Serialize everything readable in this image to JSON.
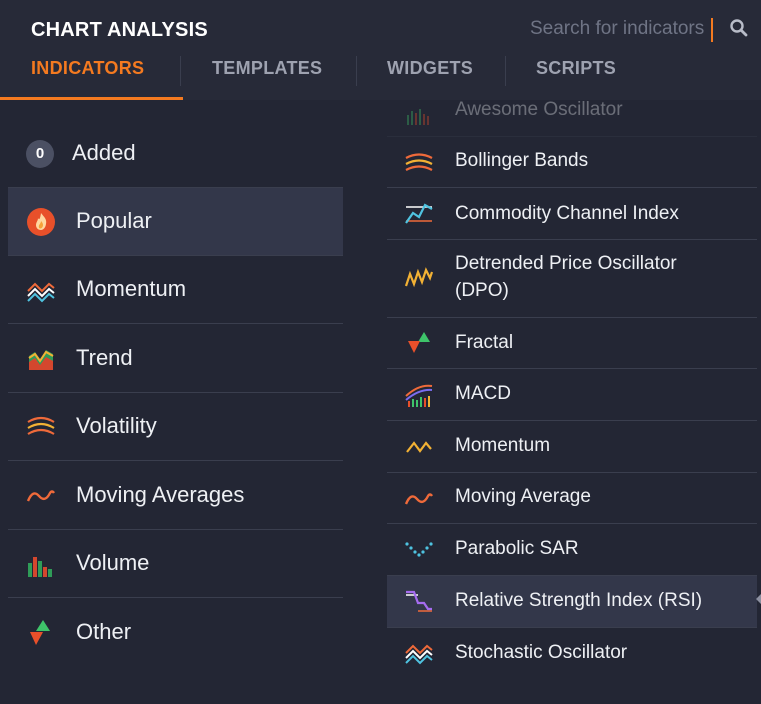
{
  "header": {
    "title": "CHART ANALYSIS",
    "search_placeholder": "Search for indicators",
    "search_icon": "search-icon"
  },
  "tabs": [
    {
      "label": "INDICATORS",
      "active": true
    },
    {
      "label": "TEMPLATES",
      "active": false
    },
    {
      "label": "WIDGETS",
      "active": false
    },
    {
      "label": "SCRIPTS",
      "active": false
    }
  ],
  "colors": {
    "accent": "#f47a20",
    "background": "#232634",
    "header": "#272a38",
    "selected_row": "#33374a"
  },
  "categories": {
    "added": {
      "count": "0",
      "label": "Added"
    },
    "items": [
      {
        "label": "Popular",
        "icon": "fire-icon",
        "active": true
      },
      {
        "label": "Momentum",
        "icon": "momentum-lines-icon"
      },
      {
        "label": "Trend",
        "icon": "trend-icon"
      },
      {
        "label": "Volatility",
        "icon": "volatility-arcs-icon"
      },
      {
        "label": "Moving Averages",
        "icon": "wave-icon"
      },
      {
        "label": "Volume",
        "icon": "volume-bars-icon"
      },
      {
        "label": "Other",
        "icon": "fractal-arrows-icon"
      }
    ]
  },
  "indicators": [
    {
      "label": "Awesome Oscillator",
      "icon": "bars-icon",
      "faded": true
    },
    {
      "label": "Bollinger Bands",
      "icon": "bands-icon"
    },
    {
      "label": "Commodity Channel Index",
      "icon": "cci-icon"
    },
    {
      "label": "Detrended Price Oscillator\n(DPO)",
      "line1": "Detrended Price Oscillator",
      "line2": "(DPO)",
      "icon": "zigzag-icon"
    },
    {
      "label": "Fractal",
      "icon": "fractal-arrows-icon"
    },
    {
      "label": "MACD",
      "icon": "macd-icon"
    },
    {
      "label": "Momentum",
      "icon": "momentum-icon"
    },
    {
      "label": "Moving Average",
      "icon": "wave-icon"
    },
    {
      "label": "Parabolic SAR",
      "icon": "dots-icon"
    },
    {
      "label": "Relative Strength Index (RSI)",
      "icon": "rsi-icon",
      "active": true
    },
    {
      "label": "Stochastic Oscillator",
      "icon": "stochastic-icon"
    }
  ]
}
